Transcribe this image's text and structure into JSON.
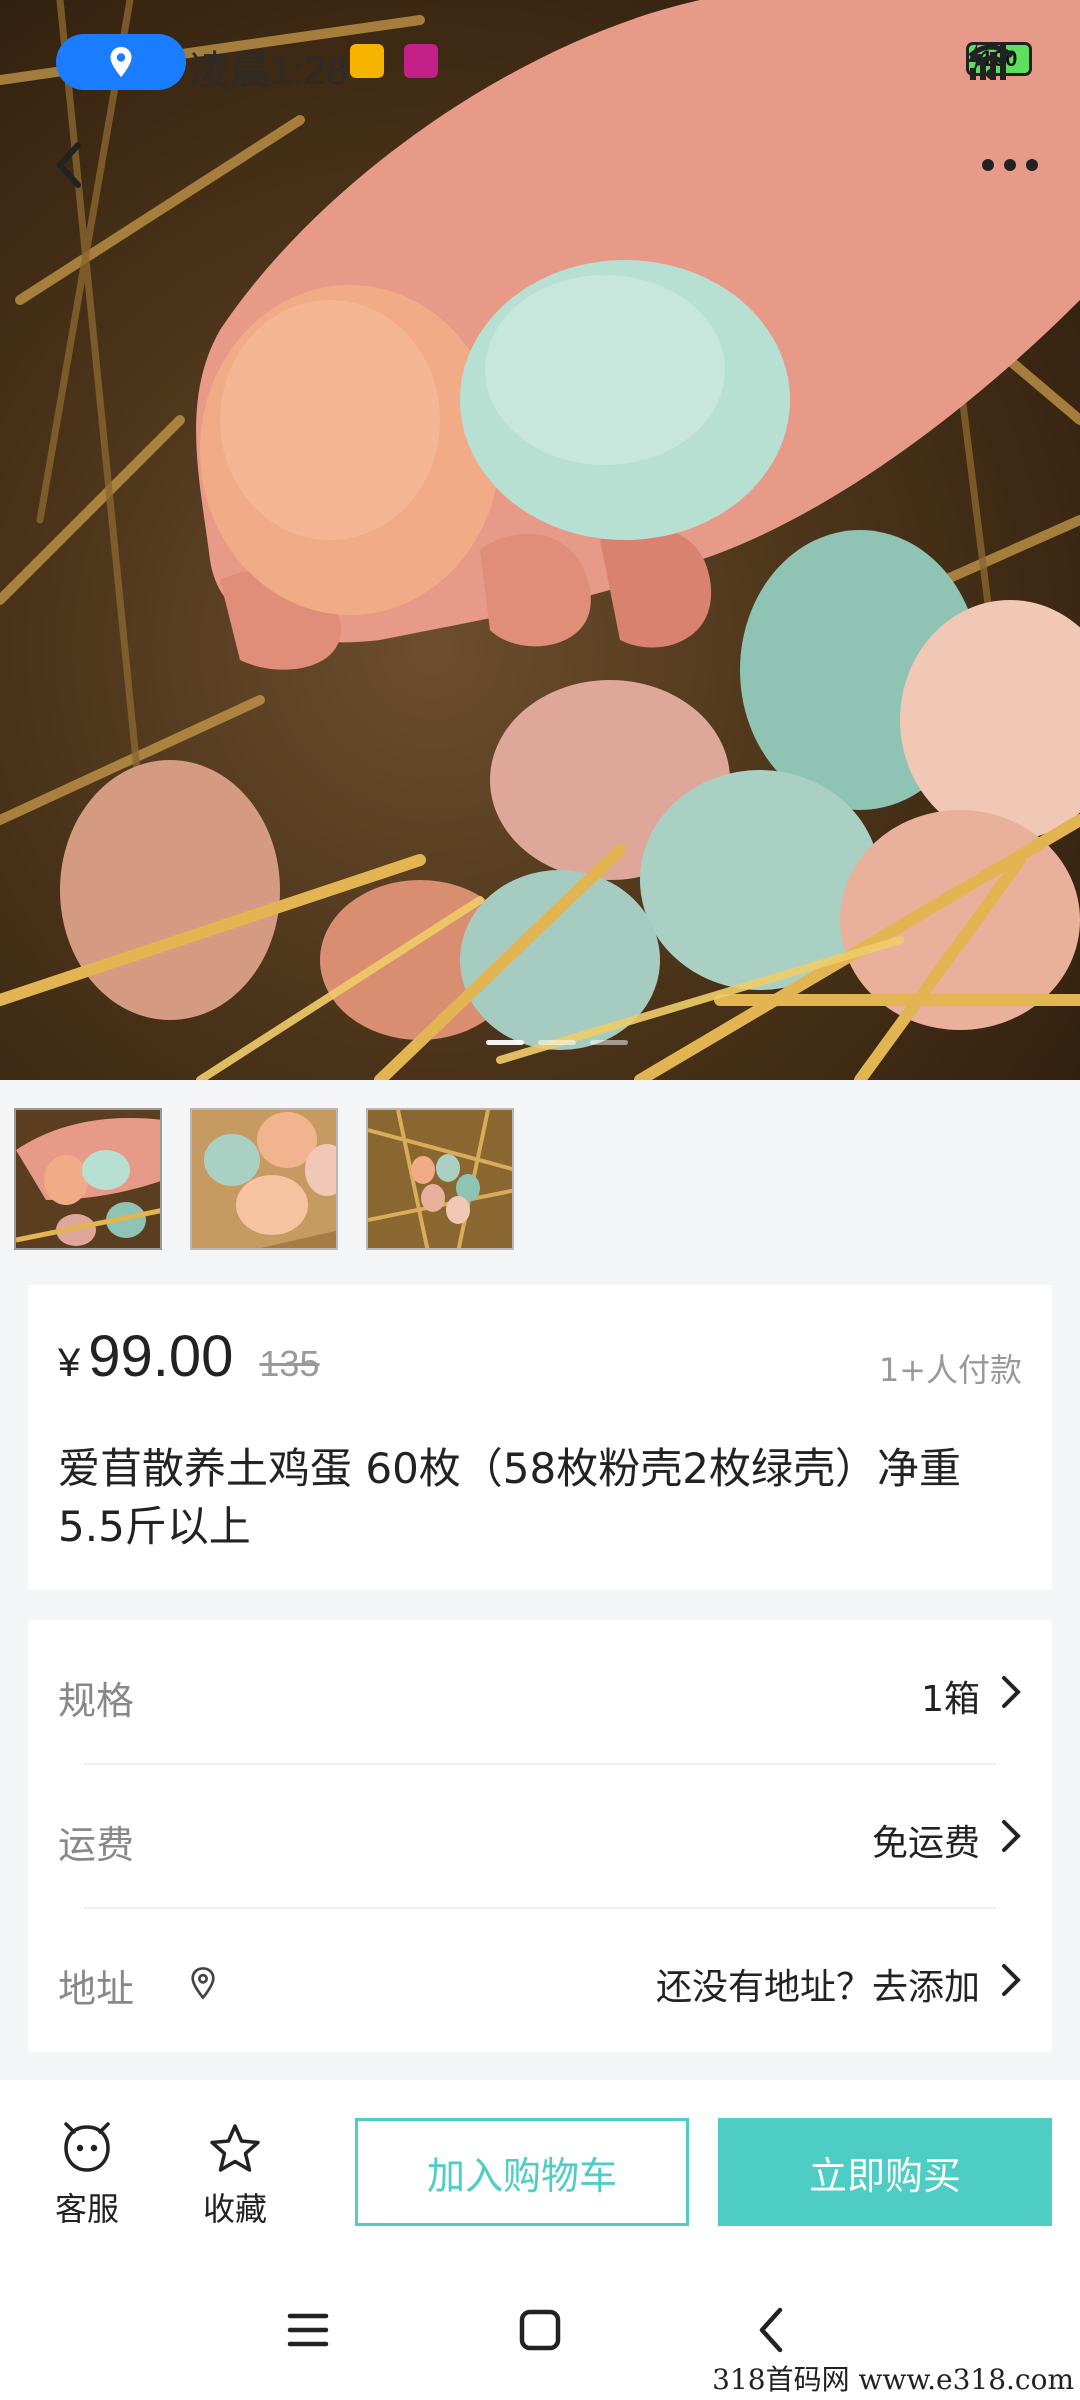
{
  "status_bar": {
    "time": "凌晨1:28",
    "battery": "100"
  },
  "gallery": {
    "current_index": 1,
    "total": 3
  },
  "product": {
    "currency": "¥",
    "price": "99.00",
    "original_price": "135",
    "buyers": "1+人付款",
    "title": "爱苜散养土鸡蛋 60枚（58枚粉壳2枚绿壳）净重5.5斤以上"
  },
  "options": [
    {
      "label": "规格",
      "value": "1箱"
    },
    {
      "label": "运费",
      "value": "免运费"
    },
    {
      "label": "地址",
      "value": "还没有地址？去添加"
    }
  ],
  "actions": {
    "service_label": "客服",
    "favorite_label": "收藏",
    "cart_label": "加入购物车",
    "buy_label": "立即购买"
  },
  "watermark": "318首码网  www.e318.com",
  "colors": {
    "accent": "#4ecdc4",
    "location_pill": "#1a7dff",
    "background": "#f4f5f7"
  }
}
